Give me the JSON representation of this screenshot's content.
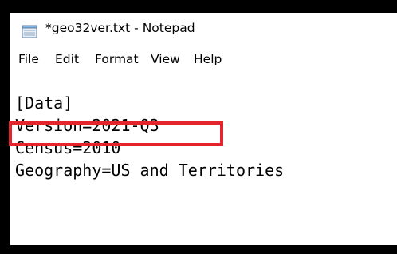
{
  "window": {
    "title": "*geo32ver.txt - Notepad",
    "app_icon": "notepad-icon"
  },
  "menu": {
    "items": [
      "File",
      "Edit",
      "Format",
      "View",
      "Help"
    ]
  },
  "editor": {
    "lines": [
      "[Data]",
      "Version=2021-Q3",
      "Census=2010",
      "Geography=US and Territories"
    ]
  },
  "annotation": {
    "highlight_color": "#e3262e",
    "highlighted_line_index": 1
  }
}
